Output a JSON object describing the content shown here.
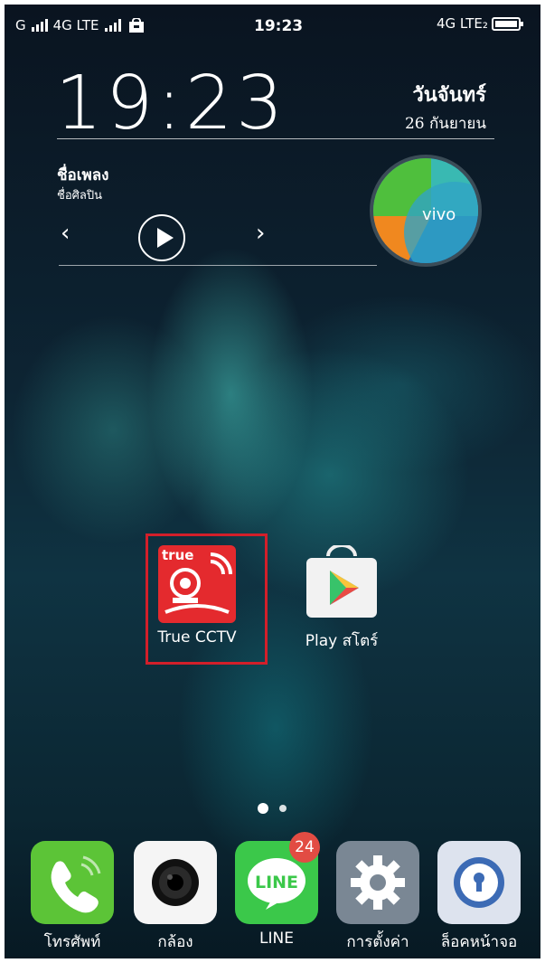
{
  "status_bar": {
    "left": "Gııll 4G LTE ııll",
    "left_carrier": "G",
    "left_net": "4G LTE",
    "time": "19:23",
    "right_net": "4G LTE₂"
  },
  "lock_widget": {
    "clock": "19:23",
    "day_name": "วันจันทร์",
    "date": "26 กันยายน",
    "song_title": "ชื่อเพลง",
    "artist": "ชื่อศิลปิน",
    "vivo_label": "vivo"
  },
  "apps": [
    {
      "label": "True CCTV",
      "logo_text": "true"
    },
    {
      "label": "Play สโตร์"
    }
  ],
  "page_indicator": {
    "current": 1,
    "total": 2
  },
  "dock": [
    {
      "label": "โทรศัพท์",
      "icon": "phone-icon"
    },
    {
      "label": "กล้อง",
      "icon": "camera-icon"
    },
    {
      "label": "LINE",
      "icon": "line-icon",
      "badge": "24",
      "icon_text": "LINE"
    },
    {
      "label": "การตั้งค่า",
      "icon": "settings-icon"
    },
    {
      "label": "ล็อคหน้าจอ",
      "icon": "lock-screen-icon"
    }
  ],
  "colors": {
    "highlight": "#d21f2a",
    "true_red": "#e42a2e",
    "phone_green": "#5cc437",
    "line_green": "#3bc84a",
    "badge_red": "#e24c43"
  }
}
